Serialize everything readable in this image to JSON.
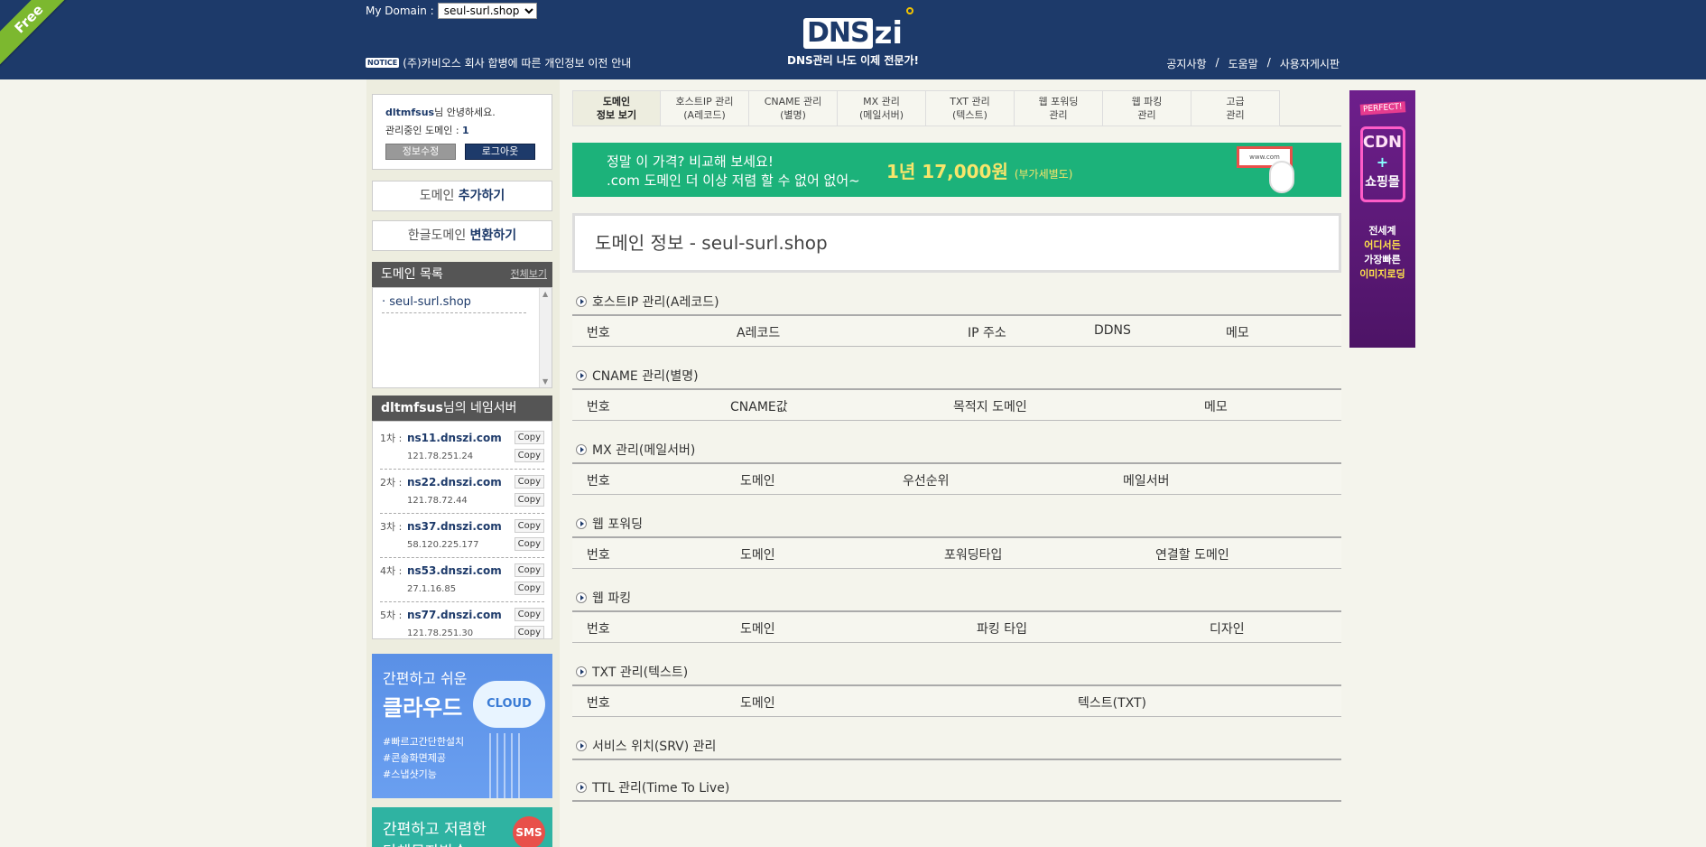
{
  "header": {
    "ribbon": "Free",
    "mydomain_label": "My Domain :",
    "mydomain_selected": "seul-surl.shop",
    "notice_badge": "NOTICE",
    "notice_text": "(주)카비오스 회사 합병에 따른 개인정보 이전 안내",
    "logo_main": "DNS",
    "logo_zi": "zi",
    "logo_tag": "DNS관리 나도 이제 전문가!",
    "nav": [
      "공지사항",
      "/",
      "도움말",
      "/",
      "사용자게시판"
    ]
  },
  "sidebar": {
    "user": "dltmfsus",
    "greeting": "님 안녕하세요.",
    "managed_label": "관리중인 도메인 :",
    "managed_count": "1",
    "edit_btn": "정보수정",
    "logout_btn": "로그아웃",
    "add_domain_pre": "도메인",
    "add_domain_bold": "추가하기",
    "convert_pre": "한글도메인",
    "convert_bold": "변환하기",
    "domain_list_title": "도메인 목록",
    "domain_list_more": "전체보기",
    "domains": [
      "· seul-surl.shop"
    ],
    "ns_title_user": "dltmfsus",
    "ns_title_suffix": "님의 네임서버",
    "nameservers": [
      {
        "num": "1차 :",
        "name": "ns11.dnszi.com",
        "ip": "121.78.251.24"
      },
      {
        "num": "2차 :",
        "name": "ns22.dnszi.com",
        "ip": "121.78.72.44"
      },
      {
        "num": "3차 :",
        "name": "ns37.dnszi.com",
        "ip": "58.120.225.177"
      },
      {
        "num": "4차 :",
        "name": "ns53.dnszi.com",
        "ip": "27.1.16.85"
      },
      {
        "num": "5차 :",
        "name": "ns77.dnszi.com",
        "ip": "121.78.251.30"
      }
    ],
    "copy_label": "Copy",
    "cloud_ad": {
      "l1": "간편하고 쉬운",
      "l2": "클라우드",
      "cloud": "CLOUD",
      "tags": [
        "#빠르고간단한설치",
        "#콘솔화면제공",
        "#스냅샷기능"
      ]
    },
    "sms_ad": {
      "l1": "간편하고 저렴한",
      "l2": "단체문자발송",
      "badge": "SMS"
    }
  },
  "tabs": [
    {
      "l1": "도메인",
      "l2": "정보 보기"
    },
    {
      "l1": "호스트IP 관리",
      "l2": "(A레코드)"
    },
    {
      "l1": "CNAME 관리",
      "l2": "(별명)"
    },
    {
      "l1": "MX 관리",
      "l2": "(메일서버)"
    },
    {
      "l1": "TXT 관리",
      "l2": "(텍스트)"
    },
    {
      "l1": "웹 포워딩",
      "l2": "관리"
    },
    {
      "l1": "웹 파킹",
      "l2": "관리"
    },
    {
      "l1": "고급",
      "l2": "관리"
    }
  ],
  "banner": {
    "t1": "정말 이 가격? 비교해 보세요!",
    "t2": ".com 도메인 더 이상 저렴 할 수 없어 없어~",
    "price": "1년 17,000원",
    "vat": "(부가세별도)",
    "monitor": "www.com"
  },
  "page_title": "도메인 정보 - seul-surl.shop",
  "sections": [
    {
      "title": "호스트IP 관리(A레코드)",
      "cols": [
        "번호",
        "A레코드",
        "IP 주소",
        "DDNS",
        "메모"
      ]
    },
    {
      "title": "CNAME 관리(별명)",
      "cols": [
        "번호",
        "CNAME값",
        "목적지 도메인",
        "메모"
      ]
    },
    {
      "title": "MX 관리(메일서버)",
      "cols": [
        "번호",
        "도메인",
        "우선순위",
        "메일서버"
      ]
    },
    {
      "title": "웹 포워딩",
      "cols": [
        "번호",
        "도메인",
        "포워딩타입",
        "연결할 도메인"
      ]
    },
    {
      "title": "웹 파킹",
      "cols": [
        "번호",
        "도메인",
        "파킹 타입",
        "디자인"
      ]
    },
    {
      "title": "TXT 관리(텍스트)",
      "cols": [
        "번호",
        "도메인",
        "텍스트(TXT)"
      ]
    },
    {
      "title": "서비스 위치(SRV) 관리",
      "cols": []
    },
    {
      "title": "TTL 관리(Time To Live)",
      "cols": []
    }
  ],
  "right_ad": {
    "perfect": "PERFECT!",
    "cdn": "CDN",
    "plus": "+",
    "shop": "쇼핑몰",
    "desc": [
      "전세계",
      "어디서든",
      "가장빠른",
      "이미지로딩"
    ]
  }
}
